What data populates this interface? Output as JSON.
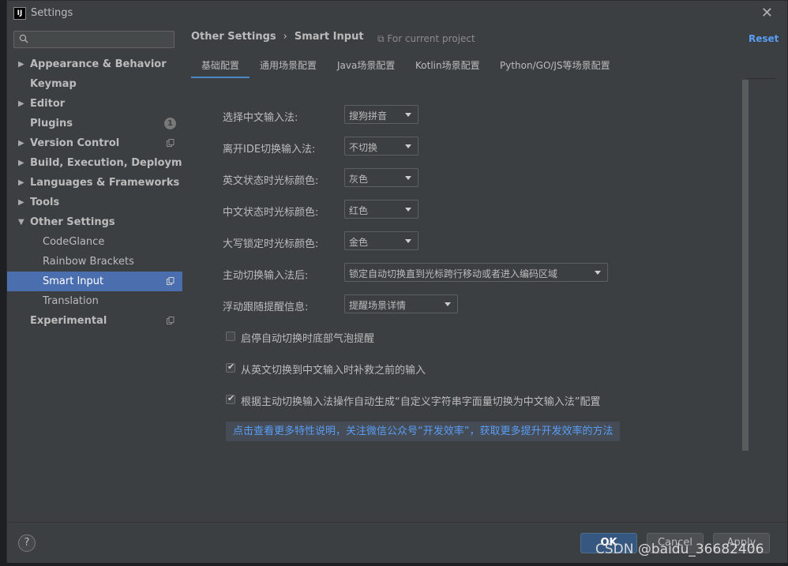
{
  "window": {
    "title": "Settings",
    "app_icon_text": "IJ"
  },
  "sidebar": {
    "search_placeholder": "",
    "items": [
      {
        "label": "Appearance & Behavior",
        "expandable": true
      },
      {
        "label": "Keymap"
      },
      {
        "label": "Editor",
        "expandable": true
      },
      {
        "label": "Plugins",
        "badge": "1"
      },
      {
        "label": "Version Control",
        "expandable": true
      },
      {
        "label": "Build, Execution, Deployment",
        "expandable": true
      },
      {
        "label": "Languages & Frameworks",
        "expandable": true
      },
      {
        "label": "Tools",
        "expandable": true
      },
      {
        "label": "Other Settings",
        "expanded": true
      },
      {
        "label": "CodeGlance"
      },
      {
        "label": "Rainbow Brackets"
      },
      {
        "label": "Smart Input",
        "selected": true
      },
      {
        "label": "Translation"
      },
      {
        "label": "Experimental"
      }
    ]
  },
  "header": {
    "breadcrumb_parent": "Other Settings",
    "breadcrumb_sep": "›",
    "breadcrumb_current": "Smart Input",
    "project_scope": "For current project",
    "reset": "Reset"
  },
  "tabs": [
    "基础配置",
    "通用场景配置",
    "Java场景配置",
    "Kotlin场景配置",
    "Python/GO/JS等场景配置"
  ],
  "form": {
    "rows": [
      {
        "label": "选择中文输入法:",
        "value": "搜狗拼音"
      },
      {
        "label": "离开IDE切换输入法:",
        "value": "不切换"
      },
      {
        "label": "英文状态时光标颜色:",
        "value": "灰色"
      },
      {
        "label": "中文状态时光标颜色:",
        "value": "红色"
      },
      {
        "label": "大写锁定时光标颜色:",
        "value": "金色"
      },
      {
        "label": "主动切换输入法后:",
        "value": "锁定自动切换直到光标跨行移动或者进入编码区域"
      },
      {
        "label": "浮动跟随提醒信息:",
        "value": "提醒场景详情"
      }
    ],
    "checks": [
      {
        "label": "启停自动切换时底部气泡提醒",
        "checked": false
      },
      {
        "label": "从英文切换到中文输入时补救之前的输入",
        "checked": true
      },
      {
        "label": "根据主动切换输入法操作自动生成“自定义字符串字面量切换为中文输入法”配置",
        "checked": true
      }
    ],
    "link": "点击查看更多特性说明，关注微信公众号“开发效率”，获取更多提升开发效率的方法"
  },
  "footer": {
    "help": "?",
    "ok": "OK",
    "cancel": "Cancel",
    "apply": "Apply"
  },
  "watermark": "CSDN @baidu_36682406",
  "colors": {
    "background": "#3c3f41",
    "selection": "#4b6eaf",
    "link": "#589df6",
    "ok_button": "#365880"
  }
}
